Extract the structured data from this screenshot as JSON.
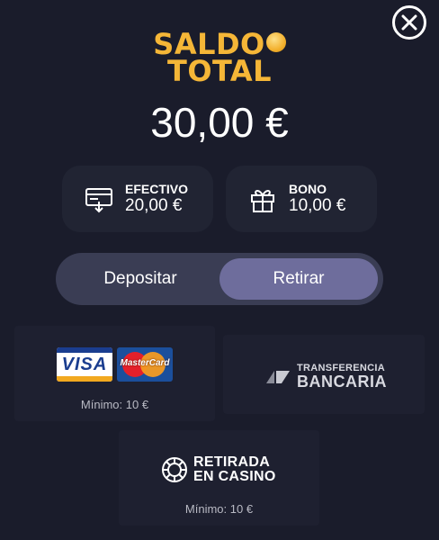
{
  "header": {
    "close_icon": "close-icon",
    "title_line1": "SALDO",
    "title_line2": "TOTAL",
    "title_color": "#f5b637",
    "total_amount": "30,00 €"
  },
  "balances": [
    {
      "icon": "cash-icon",
      "label": "EFECTIVO",
      "value": "20,00 €"
    },
    {
      "icon": "gift-icon",
      "label": "BONO",
      "value": "10,00 €"
    }
  ],
  "toggle": {
    "deposit_label": "Depositar",
    "withdraw_label": "Retirar",
    "selected": "Retirar",
    "accent": "#6e6d9c"
  },
  "methods": {
    "cards": {
      "visa_label": "VISA",
      "mastercard_label": "MasterCard",
      "minimum": "Mínimo: 10 €"
    },
    "bank": {
      "line1": "TRANSFERENCIA",
      "line2": "BANCARIA"
    },
    "casino": {
      "line1": "RETIRADA",
      "line2": "EN CASINO",
      "minimum": "Mínimo: 10 €"
    }
  }
}
